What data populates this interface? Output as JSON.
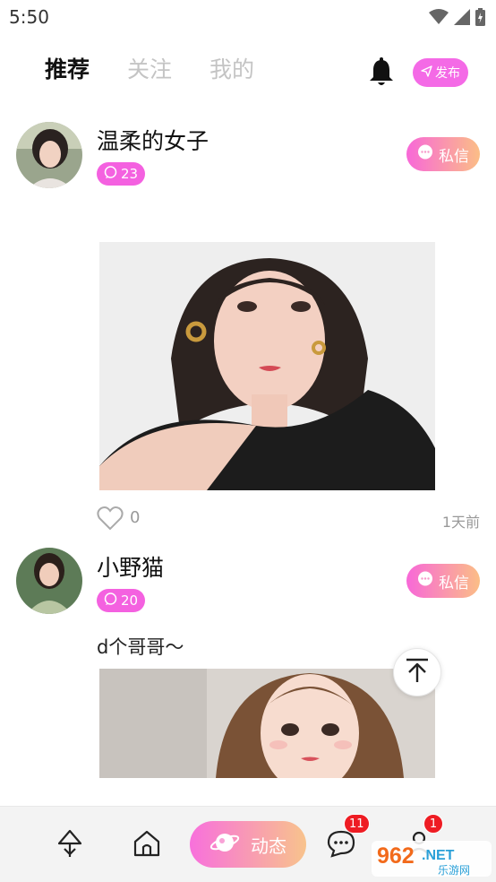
{
  "status_bar": {
    "time": "5:50"
  },
  "header": {
    "tabs": [
      {
        "label": "推荐",
        "active": true
      },
      {
        "label": "关注",
        "active": false
      },
      {
        "label": "我的",
        "active": false
      }
    ],
    "publish_label": "发布"
  },
  "posts": [
    {
      "username": "温柔的女子",
      "badge_count": "23",
      "dm_label": "私信",
      "text": "",
      "likes": "0",
      "time": "1天前"
    },
    {
      "username": "小野猫",
      "badge_count": "20",
      "dm_label": "私信",
      "text": "d个哥哥～"
    }
  ],
  "bottom_nav": {
    "main_label": "动态",
    "messages_badge": "11",
    "profile_badge": "1"
  },
  "watermark": {
    "text": "962.NET",
    "subtext": "乐游网"
  },
  "colors": {
    "accent": "#f461e0",
    "gradient_start": "#f868d8",
    "gradient_end": "#fbbe86",
    "badge_red": "#ee1c23"
  }
}
